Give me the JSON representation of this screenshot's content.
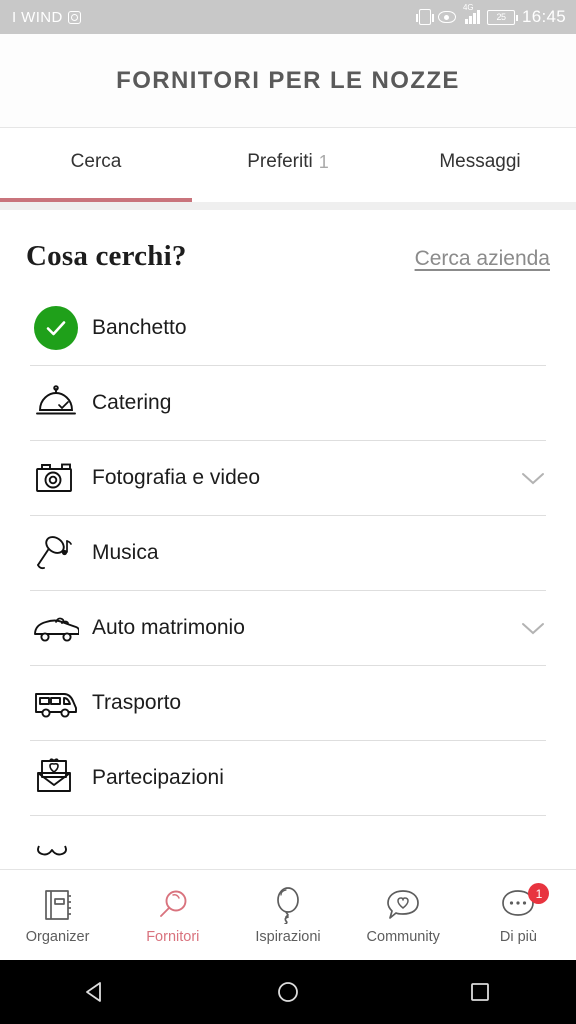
{
  "status_bar": {
    "carrier": "I WIND",
    "carrier_icon": "camera-icon",
    "vibrate_icon": "vibrate-icon",
    "eye_icon": "eye-icon",
    "network_label": "4G",
    "battery_level": "25",
    "time": "16:45",
    "background": "#c8c8c8"
  },
  "header": {
    "title": "FORNITORI PER LE NOZZE"
  },
  "tabs": {
    "items": [
      {
        "label": "Cerca",
        "count": "",
        "active": true
      },
      {
        "label": "Preferiti",
        "count": "1",
        "active": false
      },
      {
        "label": "Messaggi",
        "count": "",
        "active": false
      }
    ],
    "active_color": "#c9747c"
  },
  "search_section": {
    "title": "Cosa cerchi?",
    "link": "Cerca azienda"
  },
  "categories": [
    {
      "label": "Banchetto",
      "icon": "check-circle-icon",
      "selected": true,
      "chevron": false
    },
    {
      "label": "Catering",
      "icon": "cloche-icon",
      "selected": false,
      "chevron": false
    },
    {
      "label": "Fotografia e video",
      "icon": "camera-icon",
      "selected": false,
      "chevron": true
    },
    {
      "label": "Musica",
      "icon": "microphone-music-icon",
      "selected": false,
      "chevron": false
    },
    {
      "label": "Auto matrimonio",
      "icon": "car-icon",
      "selected": false,
      "chevron": true
    },
    {
      "label": "Trasporto",
      "icon": "bus-icon",
      "selected": false,
      "chevron": false
    },
    {
      "label": "Partecipazioni",
      "icon": "envelope-heart-icon",
      "selected": false,
      "chevron": false
    },
    {
      "label": "",
      "icon": "bow-icon",
      "selected": false,
      "chevron": false
    }
  ],
  "selected_color": "#1fa01a",
  "bottom_nav": {
    "items": [
      {
        "label": "Organizer",
        "icon": "notebook-icon",
        "active": false,
        "badge": ""
      },
      {
        "label": "Fornitori",
        "icon": "magnifier-icon",
        "active": true,
        "badge": ""
      },
      {
        "label": "Ispirazioni",
        "icon": "balloon-icon",
        "active": false,
        "badge": ""
      },
      {
        "label": "Community",
        "icon": "speech-bubble-heart-icon",
        "active": false,
        "badge": ""
      },
      {
        "label": "Di più",
        "icon": "more-dots-icon",
        "active": false,
        "badge": "1"
      }
    ],
    "active_color": "#d9737e",
    "badge_color": "#e8343f"
  },
  "system_nav": {
    "back": "back-triangle-icon",
    "home": "home-circle-icon",
    "recents": "recents-square-icon"
  }
}
